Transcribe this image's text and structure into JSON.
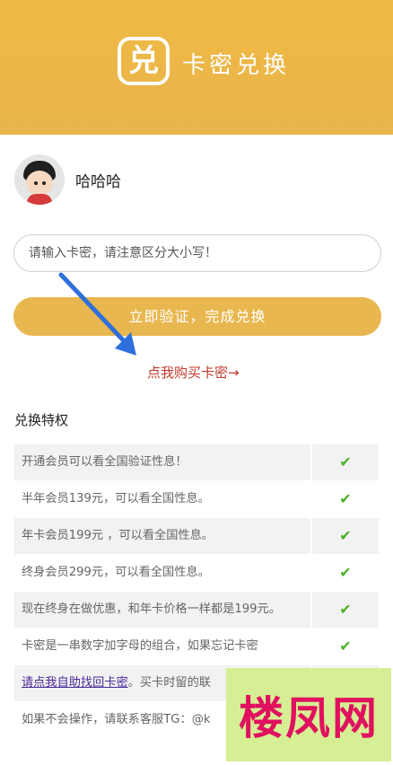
{
  "header": {
    "logo_glyph": "兑",
    "title": "卡密兑换"
  },
  "user": {
    "name": "哈哈哈"
  },
  "form": {
    "card_placeholder": "请输入卡密，请注意区分大小写！",
    "verify_label": "立即验证，完成兑换",
    "buy_link": "点我购买卡密→"
  },
  "privileges": {
    "title": "兑换特权",
    "rows": [
      {
        "text": "开通会员可以看全国验证性息！",
        "check": "✔"
      },
      {
        "text": "半年会员139元，可以看全国性息。",
        "check": "✔"
      },
      {
        "text": "年卡会员199元 ，可以看全国性息。",
        "check": "✔"
      },
      {
        "text": "终身会员299元，可以看全国性息。",
        "check": "✔"
      },
      {
        "text": "现在终身在做优惠，和年卡价格一样都是199元。",
        "check": "✔"
      },
      {
        "text": "卡密是一串数字加字母的组合，如果忘记卡密",
        "check": "✔"
      },
      {
        "link": "请点我自助找回卡密",
        "text": "。买卡时留的联",
        "check": ""
      },
      {
        "text": "如果不会操作，请联系客服TG：@k",
        "check": ""
      }
    ]
  },
  "watermark": {
    "text": "楼凤网"
  },
  "colors": {
    "header": "#f0b943",
    "button": "#e9b74f",
    "link": "#c0392b",
    "check": "#4caf26",
    "watermark_bg": "#d6ef94",
    "watermark_text": "#e0115f"
  }
}
